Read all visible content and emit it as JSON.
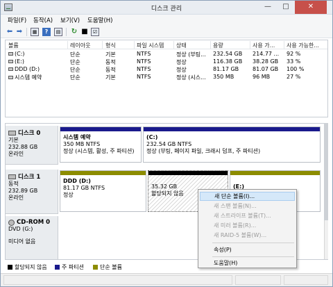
{
  "window": {
    "title": "디스크 관리"
  },
  "menu": {
    "items": [
      "파일(F)",
      "동작(A)",
      "보기(V)",
      "도움말(H)"
    ]
  },
  "toolbar": {
    "icons": [
      "back-arrow-icon",
      "forward-arrow-icon",
      "properties-grid-icon",
      "help-icon",
      "console-tree-icon",
      "refresh-icon",
      "check-disk-icon",
      "properties-icon"
    ]
  },
  "volume_list": {
    "columns": [
      "볼륨",
      "레이아웃",
      "형식",
      "파일 시스템",
      "상태",
      "용량",
      "사용 가...",
      "사용 가능한..."
    ],
    "rows": [
      {
        "volume": "(C:)",
        "layout": "단순",
        "type": "기본",
        "fs": "NTFS",
        "status": "정상 (부팅...",
        "capacity": "232.54 GB",
        "free": "214.77 ...",
        "pct": "92 %"
      },
      {
        "volume": "(E:)",
        "layout": "단순",
        "type": "동적",
        "fs": "NTFS",
        "status": "정상",
        "capacity": "116.38 GB",
        "free": "38.28 GB",
        "pct": "33 %"
      },
      {
        "volume": "DDD (D:)",
        "layout": "단순",
        "type": "동적",
        "fs": "NTFS",
        "status": "정상",
        "capacity": "81.17 GB",
        "free": "81.07 GB",
        "pct": "100 %"
      },
      {
        "volume": "시스템 예약",
        "layout": "단순",
        "type": "기본",
        "fs": "NTFS",
        "status": "정상 (시스...",
        "capacity": "350 MB",
        "free": "96 MB",
        "pct": "27 %"
      }
    ]
  },
  "disks": [
    {
      "name": "디스크 0",
      "type": "기본",
      "size": "232.88 GB",
      "state": "온라인",
      "partitions": [
        {
          "name": "시스템 예약",
          "size": "350 MB NTFS",
          "status": "정상 (시스템, 활성, 주 파티션)"
        },
        {
          "name": "(C:)",
          "size": "232.54 GB NTFS",
          "status": "정상 (부팅, 페이지 파일, 크래시 덤프, 주 파티션)"
        }
      ]
    },
    {
      "name": "디스크 1",
      "type": "동적",
      "size": "232.89 GB",
      "state": "온라인",
      "partitions": [
        {
          "name": "DDD (D:)",
          "size": "81.17 GB NTFS",
          "status": "정상"
        },
        {
          "name": "",
          "size": "35.32 GB",
          "status": "할당되지 않음"
        },
        {
          "name": "(E:)",
          "size": "",
          "status": ""
        }
      ]
    },
    {
      "name": "CD-ROM 0",
      "type": "DVD (G:)",
      "size": "",
      "state": "미디어 없음"
    }
  ],
  "legend": [
    {
      "label": "할당되지 않음",
      "color": "#000000"
    },
    {
      "label": "주 파티션",
      "color": "#1a1a8c"
    },
    {
      "label": "단순 볼륨",
      "color": "#8c8c00"
    }
  ],
  "context_menu": {
    "items": [
      {
        "label": "새 단순 볼륨(I)...",
        "enabled": true,
        "highlighted": true
      },
      {
        "label": "새 스팬 볼륨(N)...",
        "enabled": false
      },
      {
        "label": "새 스트라이프 볼륨(T)...",
        "enabled": false
      },
      {
        "label": "새 미러 볼륨(R)...",
        "enabled": false
      },
      {
        "label": "새 RAID-5 볼륨(W)...",
        "enabled": false
      },
      {
        "label": "속성(P)",
        "enabled": true
      },
      {
        "label": "도움말(H)",
        "enabled": true
      }
    ]
  },
  "colors": {
    "primary_bar": "#1a1a8c",
    "simple_bar": "#8c8c00",
    "unallocated_bar": "#000000",
    "close_button": "#c7504a"
  }
}
